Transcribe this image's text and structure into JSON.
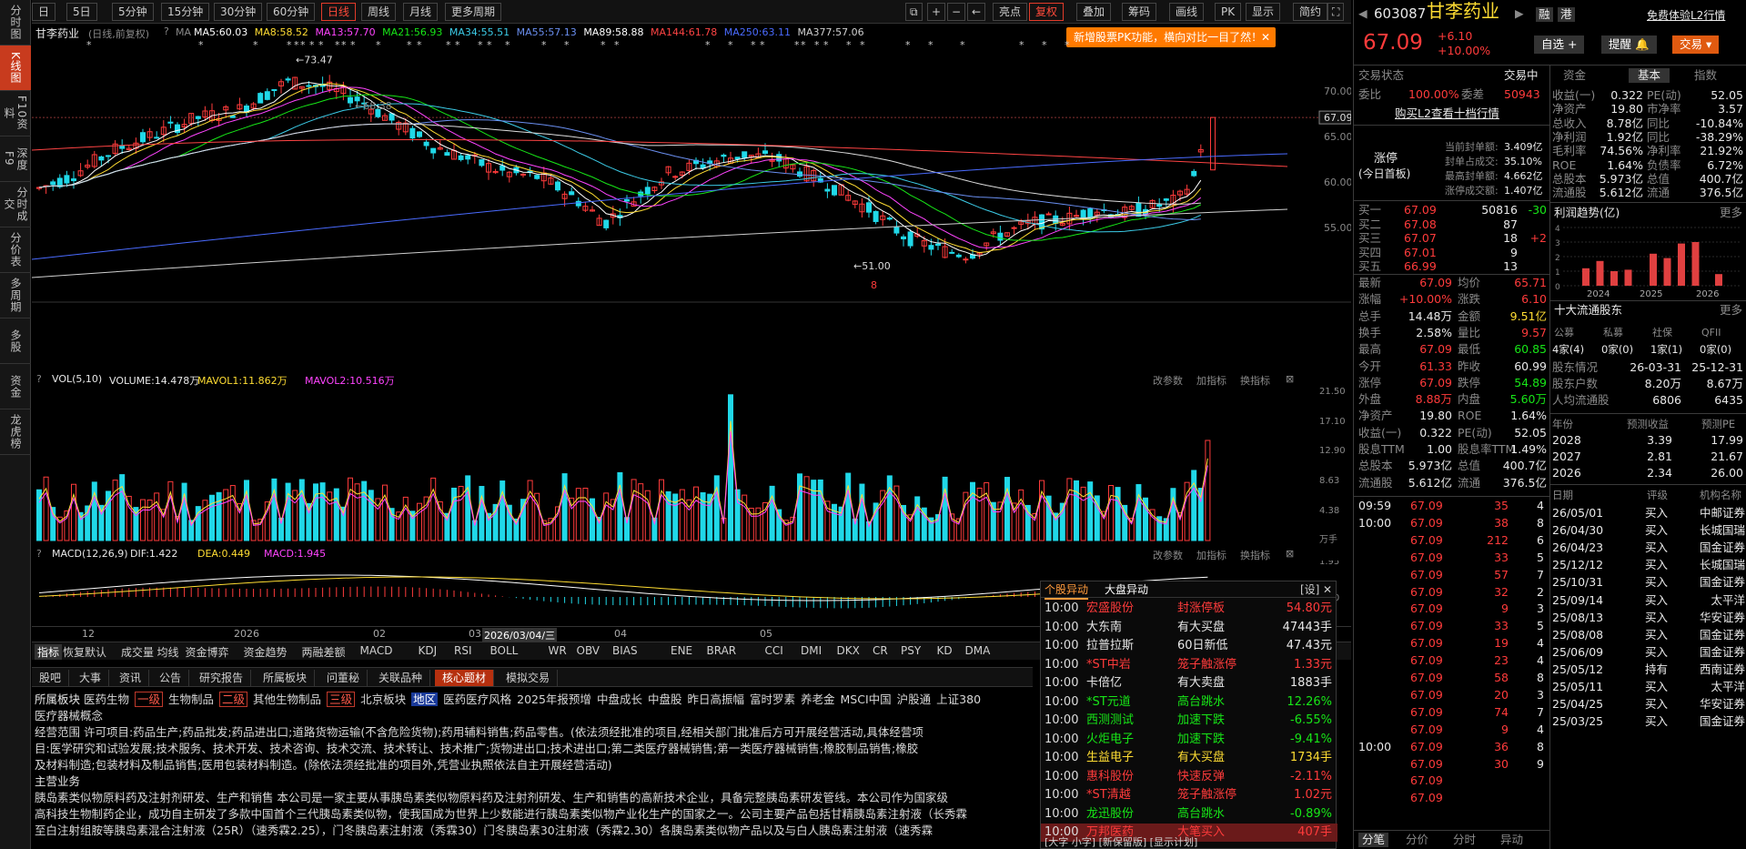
{
  "leftbar": [
    "分时图",
    "K线图",
    "F10资料",
    "深度F9",
    "分时成交",
    "分价表",
    "多周期",
    "多股",
    "资金",
    "龙虎榜"
  ],
  "topbar": {
    "items": [
      "日",
      "5日",
      "5分钟",
      "15分钟",
      "30分钟",
      "60分钟",
      "日线",
      "周线",
      "月线",
      "更多周期"
    ],
    "right": [
      "亮点",
      "复权",
      "叠加",
      "筹码",
      "画线",
      "PK",
      "显示",
      "简约"
    ]
  },
  "charthead": {
    "name": "甘李药业",
    "period": "(日线,前复权)",
    "ma": [
      {
        "t": "MA5:60.03",
        "c": "#ffffff"
      },
      {
        "t": "MA8:58.52",
        "c": "#ffdd33"
      },
      {
        "t": "MA13:57.70",
        "c": "#ff44ff"
      },
      {
        "t": "MA21:56.93",
        "c": "#17e617"
      },
      {
        "t": "MA34:55.51",
        "c": "#3ccce8"
      },
      {
        "t": "MA55:57.13",
        "c": "#6a8ff0"
      },
      {
        "t": "MA89:58.88",
        "c": "#ffffff"
      },
      {
        "t": "MA144:61.78",
        "c": "#ff4444"
      },
      {
        "t": "MA250:63.11",
        "c": "#4a6bff"
      },
      {
        "t": "MA377:57.06",
        "c": "#d0d0d0"
      }
    ]
  },
  "notice": "新增股票PK功能，横向对比一目了然！",
  "main": {
    "y_labels": [
      "70.00",
      "65.00",
      "60.00",
      "55.00"
    ],
    "price_tag": "67.09",
    "high": "73.47",
    "mid": "68.38",
    "low": "51.00",
    "marker": "8"
  },
  "vol": {
    "head": "VOL(5,10)",
    "v1": "VOLUME:14.478万",
    "v2": "MAVOL1:11.862万",
    "v3": "MAVOL2:10.516万",
    "y_labels": [
      "21.50",
      "17.10",
      "12.90",
      "8.63",
      "4.38",
      "万手"
    ],
    "ctrl": [
      "改参数",
      "加指标",
      "换指标"
    ]
  },
  "macd": {
    "head": "MACD(12,26,9)",
    "dif": "DIF:1.422",
    "dea": "DEA:0.449",
    "m": "MACD:1.945",
    "y_labels": [
      "1.95",
      "0.00"
    ]
  },
  "dates": [
    "12",
    "2026",
    "02",
    "03",
    "2026/03/04/三",
    "04",
    "05"
  ],
  "indtabs": [
    "指标",
    "恢复默认",
    "成交量",
    "均线",
    "资金博弈",
    "资金趋势",
    "两融差额",
    "MACD",
    "KDJ",
    "RSI",
    "BOLL",
    "WR",
    "OBV",
    "BIAS",
    "ENE",
    "BRAR",
    "CCI",
    "DMI",
    "DKX",
    "CR",
    "PSY",
    "KD",
    "DMA"
  ],
  "infotabs": [
    "股吧",
    "大事",
    "资讯",
    "公告",
    "研究报告",
    "所属板块",
    "问董秘",
    "关联品种",
    "核心题材",
    "模拟交易"
  ],
  "info": {
    "l1_label": "所属板块",
    "l1": [
      "医药生物",
      "一级",
      "生物制品",
      "二级",
      "其他生物制品",
      "三级",
      "北京板块",
      "地区",
      "医药医疗风格",
      "2025年报预增",
      "中盘成长",
      "中盘股",
      "昨日高振幅",
      "富时罗素",
      "养老金",
      "MSCI中国",
      "沪股通",
      "上证380"
    ],
    "l2": "医疗器械概念",
    "l3": "经营范围  许可项目:药品生产;药品批发;药品进出口;道路货物运输(不含危险货物);药用辅料销售;药品零售。(依法须经批准的项目,经相关部门批准后方可开展经营活动,具体经营项",
    "l4": "目:医学研究和试验发展;技术服务、技术开发、技术咨询、技术交流、技术转让、技术推广;货物进出口;技术进出口;第二类医疗器械销售;第一类医疗器械销售;橡胶制品销售;橡胶",
    "l5": "及材料制造;包装材料及制品销售;医用包装材料制造。(除依法须经批准的项目外,凭营业执照依法自主开展经营活动)",
    "l6": "主营业务",
    "l7": "胰岛素类似物原料药及注射剂研发、生产和销售  本公司是一家主要从事胰岛素类似物原料药及注射剂研发、生产和销售的高新技术企业，具备完整胰岛素研发管线。本公司作为国家级",
    "l8": "高科技生物制药企业，成功自主研发了多款中国首个三代胰岛素类似物，使我国成为世界上少数能进行胰岛素类似物产业化生产的国家之一。公司主要产品包括甘精胰岛素注射液（长秀霖",
    "l9": "至白注射组胺等胰岛素混合注射液（25R）（速秀霖2.25），门冬胰岛素注射液（秀霖30）门冬胰岛素30注射液（秀霖2.30）各胰岛素类似物产品以及与白人胰岛素注射液（速秀霖"
  },
  "alerts": {
    "tabs": [
      "个股异动",
      "大盘异动",
      "[设]"
    ],
    "rows": [
      [
        "10:00",
        "宏盛股份",
        "封涨停板",
        "54.80元"
      ],
      [
        "10:00",
        "大东南",
        "有大买盘",
        "47443手"
      ],
      [
        "10:00",
        "拉普拉斯",
        "60日新低",
        "47.43元"
      ],
      [
        "10:00",
        "*ST中岩",
        "笼子触涨停",
        "1.33元"
      ],
      [
        "10:00",
        "卡倍亿",
        "有大卖盘",
        "1883手"
      ],
      [
        "10:00",
        "*ST元道",
        "高台跳水",
        "12.26%"
      ],
      [
        "10:00",
        "西测测试",
        "加速下跌",
        "-6.55%"
      ],
      [
        "10:00",
        "火炬电子",
        "加速下跌",
        "-9.41%"
      ],
      [
        "10:00",
        "生益电子",
        "有大买盘",
        "1734手"
      ],
      [
        "10:00",
        "惠科股份",
        "快速反弹",
        "-2.11%"
      ],
      [
        "10:00",
        "*ST清越",
        "笼子触涨停",
        "1.02元"
      ],
      [
        "10:00",
        "龙迅股份",
        "高台跳水",
        "-0.89%"
      ],
      [
        "10:00",
        "万邦医药",
        "大笔买入",
        "407手"
      ]
    ],
    "footer": "[大字 小字] [新保留版]  [显示计划]"
  },
  "rp": {
    "code": "603087",
    "name": "甘李药业",
    "tags": [
      "融",
      "港"
    ],
    "free": "免费体验L2行情",
    "price": "67.09",
    "chg": "+6.10",
    "pct": "+10.00%",
    "btns": [
      "自选",
      "提醒",
      "交易"
    ],
    "status_l": "交易状态",
    "status_r": "交易中",
    "weibi": "委比",
    "weibi_v": "100.00%",
    "weicha": "委差",
    "weicha_v": "50943",
    "buyl2": "购买L2查看十档行情",
    "zt": {
      "label": "涨停",
      "sub": "(今日首板)",
      "rows": [
        [
          "当前封单额:",
          "3.409亿"
        ],
        [
          "封单占成交:",
          "35.10%"
        ],
        [
          "最高封单额:",
          "4.662亿"
        ],
        [
          "涨停成交额:",
          "1.407亿"
        ]
      ]
    },
    "bids": [
      [
        "买一",
        "67.09",
        "50816",
        "-30"
      ],
      [
        "买二",
        "67.08",
        "87",
        ""
      ],
      [
        "买三",
        "67.07",
        "18",
        "+2"
      ],
      [
        "买四",
        "67.01",
        "9",
        ""
      ],
      [
        "买五",
        "66.99",
        "13",
        ""
      ]
    ],
    "stats": [
      [
        "最新",
        "67.09",
        "均价",
        "65.71"
      ],
      [
        "涨幅",
        "+10.00%",
        "涨跌",
        "6.10"
      ],
      [
        "总手",
        "14.48万",
        "金额",
        "9.51亿"
      ],
      [
        "换手",
        "2.58%",
        "量比",
        "9.57"
      ],
      [
        "最高",
        "67.09",
        "最低",
        "60.85"
      ],
      [
        "今开",
        "61.33",
        "昨收",
        "60.99"
      ],
      [
        "涨停",
        "67.09",
        "跌停",
        "54.89"
      ],
      [
        "外盘",
        "8.88万",
        "内盘",
        "5.60万"
      ],
      [
        "净资产",
        "19.80",
        "ROE",
        "1.64%"
      ],
      [
        "收益(一)",
        "0.322",
        "PE(动)",
        "52.05"
      ],
      [
        "股息TTM",
        "1.00",
        "股息率TTM",
        "1.49%"
      ],
      [
        "总股本",
        "5.973亿",
        "总值",
        "400.7亿"
      ],
      [
        "流通股",
        "5.612亿",
        "流通",
        "376.5亿"
      ]
    ],
    "ticks": [
      [
        "09:59",
        "67.09",
        "35",
        "4"
      ],
      [
        "10:00",
        "67.09",
        "38",
        "8"
      ],
      [
        "",
        "67.09",
        "212",
        "6"
      ],
      [
        "",
        "67.09",
        "33",
        "5"
      ],
      [
        "",
        "67.09",
        "57",
        "7"
      ],
      [
        "",
        "67.09",
        "32",
        "2"
      ],
      [
        "",
        "67.09",
        "9",
        "3"
      ],
      [
        "",
        "67.09",
        "33",
        "5"
      ],
      [
        "",
        "67.09",
        "19",
        "4"
      ],
      [
        "",
        "67.09",
        "23",
        "4"
      ],
      [
        "",
        "67.09",
        "58",
        "8"
      ],
      [
        "",
        "67.09",
        "20",
        "3"
      ],
      [
        "",
        "67.09",
        "74",
        "7"
      ],
      [
        "",
        "67.09",
        "9",
        "4"
      ],
      [
        "10:00",
        "67.09",
        "36",
        "8"
      ],
      [
        "",
        "67.09",
        "30",
        "9"
      ],
      [
        "",
        "67.09",
        "",
        ""
      ],
      [
        "",
        "67.09",
        "",
        ""
      ]
    ],
    "bottomtabs": [
      "分笔",
      "分价",
      "分时",
      "异动"
    ],
    "ftabs": [
      "资金",
      "基本",
      "指数"
    ],
    "fund": [
      [
        "收益(一)",
        "0.322",
        "PE(动)",
        "52.05"
      ],
      [
        "净资产",
        "19.80",
        "市净率",
        "3.57"
      ],
      [
        "总收入",
        "8.78亿",
        "同比",
        "-10.84%"
      ],
      [
        "净利润",
        "1.92亿",
        "同比",
        "-38.29%"
      ],
      [
        "毛利率",
        "74.56%",
        "净利率",
        "21.92%"
      ],
      [
        "ROE",
        "1.64%",
        "负债率",
        "6.72%"
      ],
      [
        "总股本",
        "5.973亿",
        "总值",
        "400.7亿"
      ],
      [
        "流通股",
        "5.612亿",
        "流通",
        "376.5亿"
      ]
    ],
    "trend_title": "利润趋势(亿)",
    "more": "更多",
    "trend": {
      "y_labels": [
        "4",
        "3",
        "2",
        "1",
        "0"
      ],
      "years": [
        "2024",
        "2025",
        "2026"
      ],
      "bars": [
        1.2,
        1.7,
        1.0,
        1.1,
        2.2,
        1.9,
        2.9,
        3.0,
        0.8
      ]
    },
    "holders_title": "十大流通股东",
    "holders_head": [
      "公募",
      "私募",
      "社保",
      "QFII"
    ],
    "holders_val": [
      "4家(4)",
      "0家(0)",
      "1家(1)",
      "0家(0)"
    ],
    "holders_rows": [
      [
        "股东情况",
        "26-03-31",
        "25-12-31"
      ],
      [
        "股东户数",
        "8.20万",
        "8.67万"
      ],
      [
        "人均流通股",
        "6806",
        "6435"
      ]
    ],
    "fc_head": [
      "年份",
      "预测收益",
      "预测PE"
    ],
    "fc": [
      [
        "2028",
        "3.39",
        "17.99"
      ],
      [
        "2027",
        "2.81",
        "21.67"
      ],
      [
        "2026",
        "2.34",
        "26.00"
      ]
    ],
    "rt_head": [
      "日期",
      "评级",
      "机构名称"
    ],
    "ratings": [
      [
        "26/05/01",
        "买入",
        "中邮证券"
      ],
      [
        "26/04/30",
        "买入",
        "长城国瑞"
      ],
      [
        "26/04/23",
        "买入",
        "国金证券"
      ],
      [
        "25/12/12",
        "买入",
        "长城国瑞"
      ],
      [
        "25/10/31",
        "买入",
        "国金证券"
      ],
      [
        "25/09/14",
        "买入",
        "太平洋"
      ],
      [
        "25/08/13",
        "买入",
        "华安证券"
      ],
      [
        "25/08/08",
        "买入",
        "国金证券"
      ],
      [
        "25/06/09",
        "买入",
        "国金证券"
      ],
      [
        "25/05/12",
        "持有",
        "西南证券"
      ],
      [
        "25/05/11",
        "买入",
        "太平洋"
      ],
      [
        "25/04/25",
        "买入",
        "华安证券"
      ],
      [
        "25/03/25",
        "买入",
        "国金证券"
      ]
    ]
  }
}
